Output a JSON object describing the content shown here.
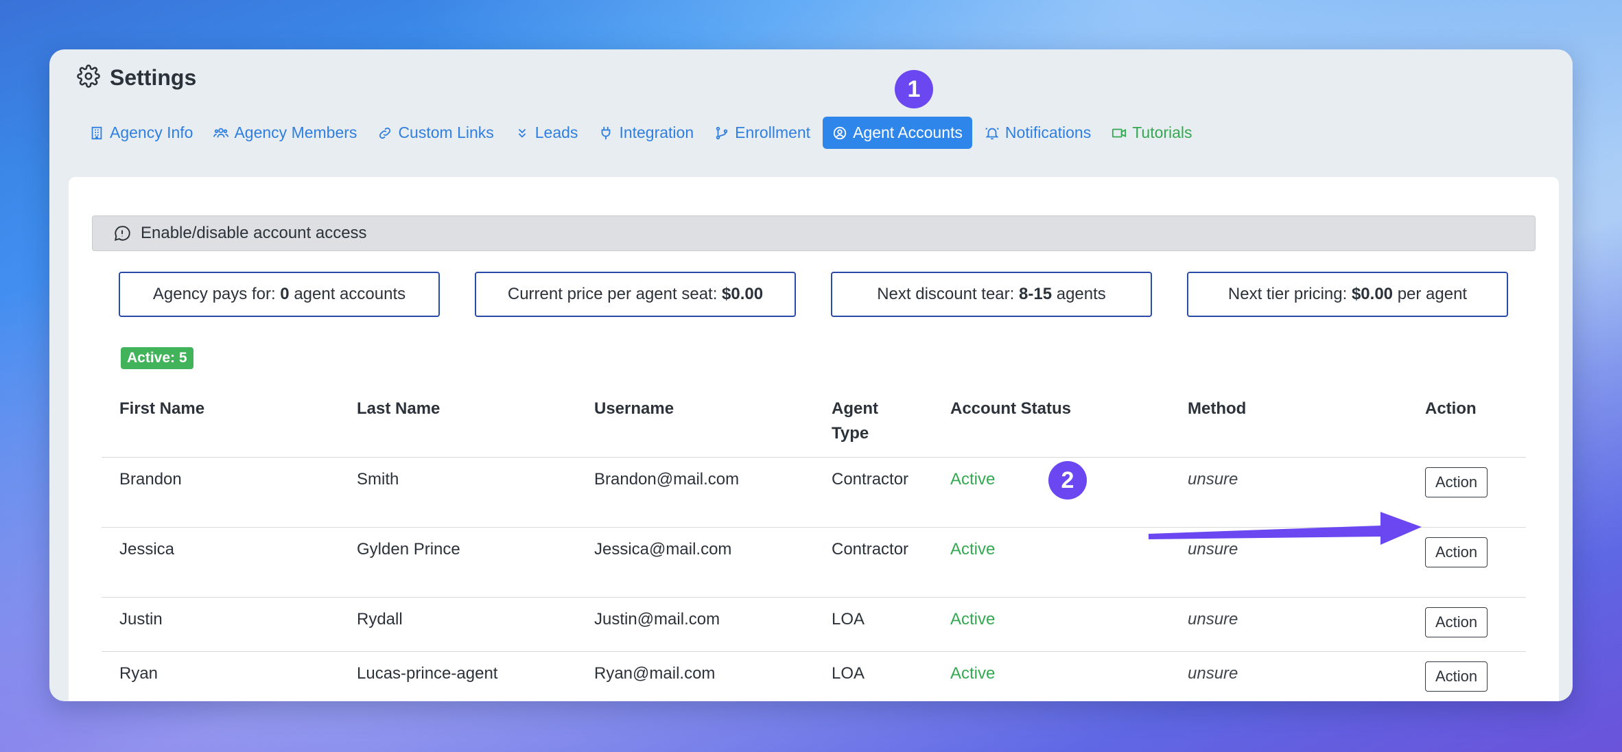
{
  "page": {
    "title": "Settings"
  },
  "tabs": [
    {
      "label": "Agency Info",
      "icon": "building-icon",
      "style": "normal"
    },
    {
      "label": "Agency Members",
      "icon": "users-icon",
      "style": "normal"
    },
    {
      "label": "Custom Links",
      "icon": "link-icon",
      "style": "normal"
    },
    {
      "label": "Leads",
      "icon": "chevrons-down-icon",
      "style": "normal"
    },
    {
      "label": "Integration",
      "icon": "plug-icon",
      "style": "normal"
    },
    {
      "label": "Enrollment",
      "icon": "git-branch-icon",
      "style": "normal"
    },
    {
      "label": "Agent Accounts",
      "icon": "user-circle-icon",
      "style": "active"
    },
    {
      "label": "Notifications",
      "icon": "bell-icon",
      "style": "normal"
    },
    {
      "label": "Tutorials",
      "icon": "video-icon",
      "style": "green"
    }
  ],
  "annotations": {
    "step1": "1",
    "step2": "2"
  },
  "info_bar": {
    "text": "Enable/disable account access"
  },
  "stats": [
    {
      "pre": "Agency pays for: ",
      "bold": "0",
      "post": " agent accounts"
    },
    {
      "pre": "Current price per agent seat: ",
      "bold": "$0.00",
      "post": ""
    },
    {
      "pre": "Next discount tear: ",
      "bold": "8-15",
      "post": " agents"
    },
    {
      "pre": "Next tier pricing: ",
      "bold": "$0.00",
      "post": " per agent"
    }
  ],
  "active_count": "Active: 5",
  "table": {
    "headers": [
      "First Name",
      "Last Name",
      "Username",
      "Agent Type",
      "Account Status",
      "Method",
      "Action"
    ],
    "rows": [
      {
        "first": "Brandon",
        "last": "Smith",
        "username": "Brandon@mail.com",
        "type": "Contractor",
        "status": "Active",
        "method": "unsure",
        "action": "Action"
      },
      {
        "first": "Jessica",
        "last": "Gylden Prince",
        "username": "Jessica@mail.com",
        "type": "Contractor",
        "status": "Active",
        "method": "unsure",
        "action": "Action"
      },
      {
        "first": "Justin",
        "last": "Rydall",
        "username": "Justin@mail.com",
        "type": "LOA",
        "status": "Active",
        "method": "unsure",
        "action": "Action"
      },
      {
        "first": "Ryan",
        "last": "Lucas-prince-agent",
        "username": "Ryan@mail.com",
        "type": "LOA",
        "status": "Active",
        "method": "unsure",
        "action": "Action"
      }
    ]
  },
  "colors": {
    "accent": "#2f86ea",
    "annotation": "#6a47f0",
    "success": "#35a852"
  }
}
